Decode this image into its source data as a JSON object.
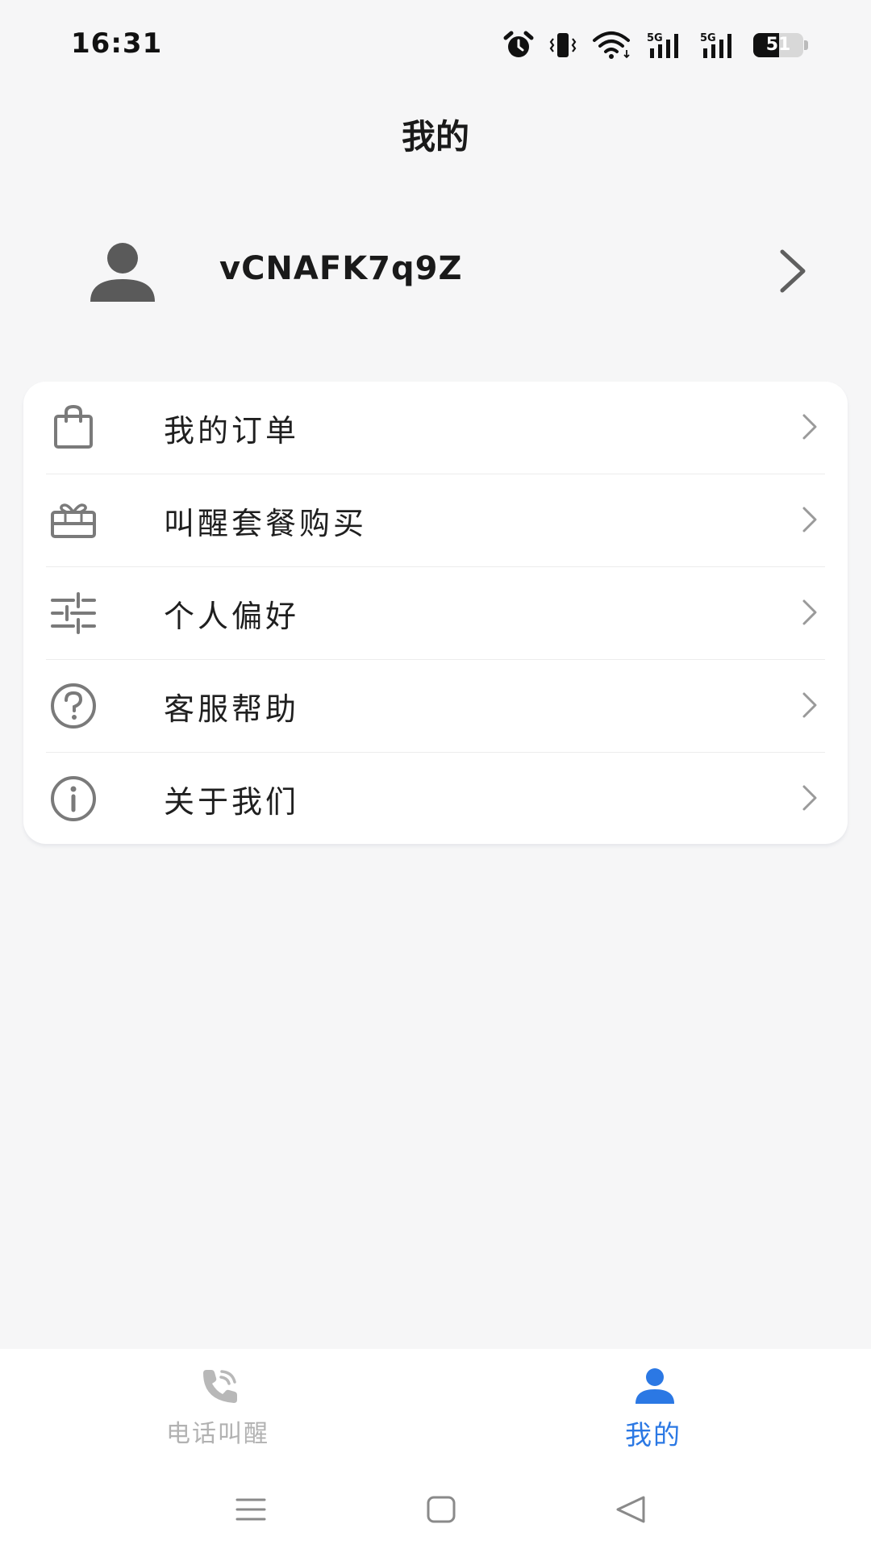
{
  "status_bar": {
    "time": "16:31",
    "battery_level": "51",
    "battery_fraction": 0.51,
    "icons": [
      "alarm-icon",
      "vibrate-icon",
      "wifi-icon",
      "signal-5g-icon",
      "signal-5g-icon",
      "battery-icon"
    ]
  },
  "header": {
    "title": "我的"
  },
  "profile": {
    "username": "vCNAFK7q9Z",
    "avatar_icon": "person-icon",
    "chevron_icon": "chevron-right-icon"
  },
  "menu": {
    "items": [
      {
        "label": "我的订单",
        "icon": "shopping-bag-icon"
      },
      {
        "label": "叫醒套餐购买",
        "icon": "gift-card-icon"
      },
      {
        "label": "个人偏好",
        "icon": "sliders-icon"
      },
      {
        "label": "客服帮助",
        "icon": "help-circle-icon"
      },
      {
        "label": "关于我们",
        "icon": "info-circle-icon"
      }
    ]
  },
  "tab_bar": {
    "tabs": [
      {
        "label": "电话叫醒",
        "icon": "phone-call-icon",
        "active": false
      },
      {
        "label": "我的",
        "icon": "person-icon",
        "active": true
      }
    ],
    "active_color": "#2b78e4",
    "inactive_color": "#b2b2b2"
  },
  "nav_bar": {
    "buttons": [
      "menu-icon",
      "home-icon",
      "back-icon"
    ]
  }
}
